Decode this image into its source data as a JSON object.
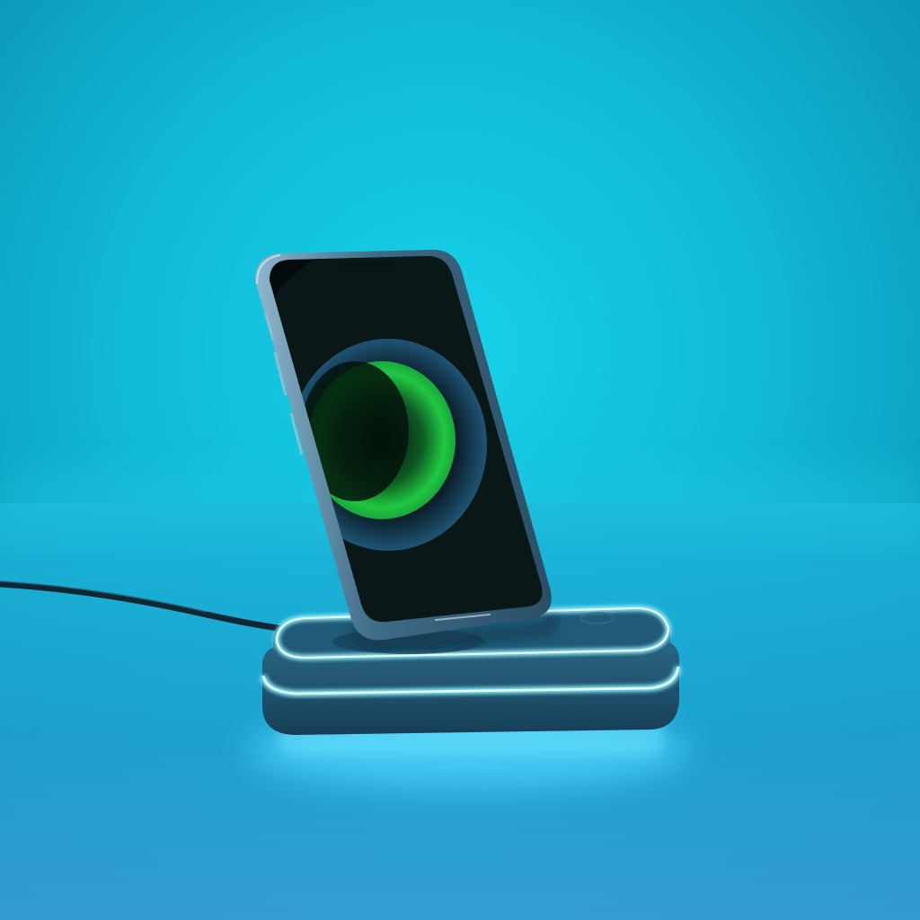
{
  "scene": {
    "subject": "smartphone-on-wireless-charging-stand",
    "icons": [
      "phone",
      "charging-dock",
      "usb-cable",
      "glow-ring"
    ]
  },
  "colors": {
    "backdrop_light": "#15c6df",
    "backdrop_dark": "#0a8fb0",
    "floor": "#1aa4cc",
    "phone_frame": "#3d6a86",
    "phone_screen": "#050a0c",
    "screen_glow_green": "#1bbf3a",
    "screen_ring_blue": "#1b4a6a",
    "dock_body": "#1d4f6a",
    "dock_glow": "#7ff4ff",
    "cable": "#0d2734"
  }
}
